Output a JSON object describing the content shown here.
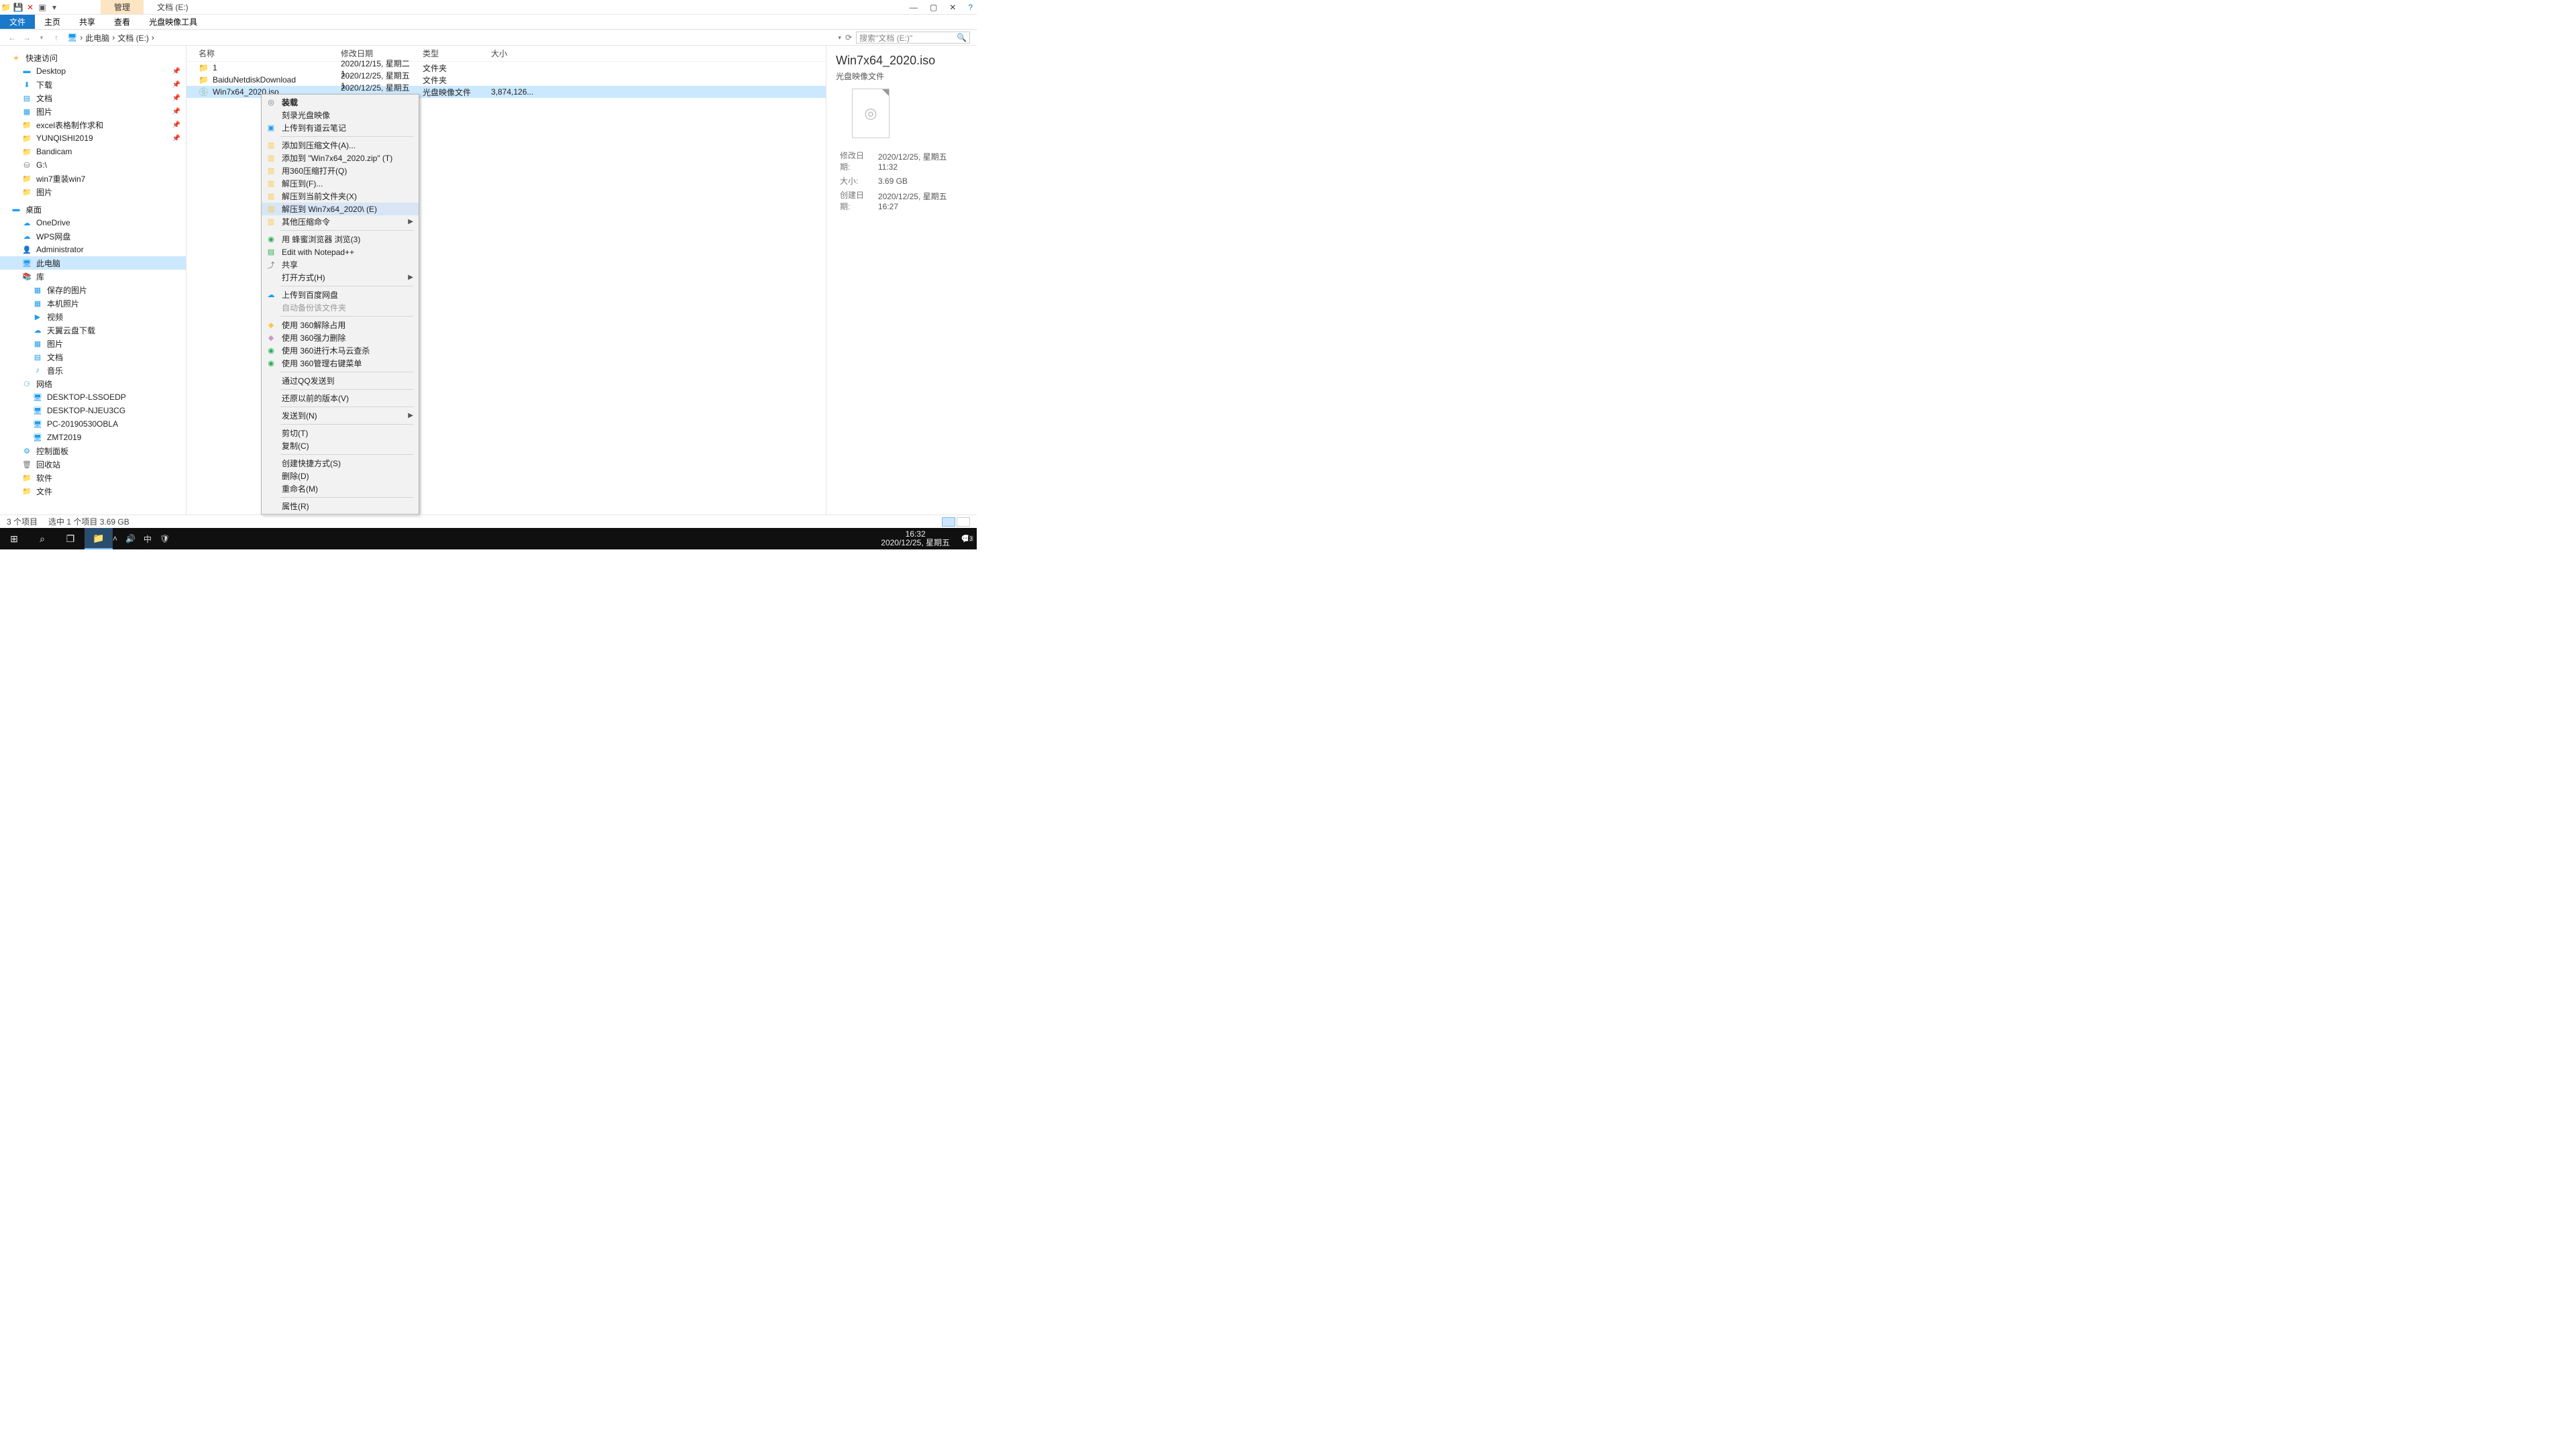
{
  "window": {
    "manage_tab": "管理",
    "location_title": "文档 (E:)",
    "min": "—",
    "max": "▢",
    "close": "✕",
    "help": "?"
  },
  "ribbon": {
    "file": "文件",
    "home": "主页",
    "share": "共享",
    "view": "查看",
    "iso_tools": "光盘映像工具"
  },
  "addr": {
    "this_pc": "此电脑",
    "drive": "文档 (E:)",
    "search_placeholder": "搜索\"文档 (E:)\"",
    "refresh": "⟳"
  },
  "nav": {
    "quick": "快速访问",
    "desktop": "Desktop",
    "downloads": "下载",
    "documents": "文档",
    "pictures_q": "图片",
    "excel": "excel表格制作求和",
    "yunqishi": "YUNQISHI2019",
    "bandicam": "Bandicam",
    "gdrive": "G:\\",
    "win7": "win7重装win7",
    "pictures2": "图片",
    "desktop_root": "桌面",
    "onedrive": "OneDrive",
    "wps": "WPS网盘",
    "admin": "Administrator",
    "this_pc": "此电脑",
    "libraries": "库",
    "saved_pics": "保存的图片",
    "local_photos": "本机照片",
    "videos": "视频",
    "tianyi": "天翼云盘下载",
    "pictures": "图片",
    "docs": "文档",
    "music": "音乐",
    "network": "网络",
    "pc1": "DESKTOP-LSSOEDP",
    "pc2": "DESKTOP-NJEU3CG",
    "pc3": "PC-20190530OBLA",
    "pc4": "ZMT2019",
    "control": "控制面板",
    "recycle": "回收站",
    "software": "软件",
    "files": "文件"
  },
  "cols": {
    "name": "名称",
    "date": "修改日期",
    "type": "类型",
    "size": "大小"
  },
  "rows": [
    {
      "name": "1",
      "date": "2020/12/15, 星期二 1...",
      "type": "文件夹",
      "size": ""
    },
    {
      "name": "BaiduNetdiskDownload",
      "date": "2020/12/25, 星期五 1...",
      "type": "文件夹",
      "size": ""
    },
    {
      "name": "Win7x64_2020.iso",
      "date": "2020/12/25, 星期五 1...",
      "type": "光盘映像文件",
      "size": "3,874,126..."
    }
  ],
  "ctx": {
    "mount": "装载",
    "burn": "刻录光盘映像",
    "youdao": "上传到有道云笔记",
    "add_archive": "添加到压缩文件(A)...",
    "add_zip": "添加到 \"Win7x64_2020.zip\" (T)",
    "open_360": "用360压缩打开(Q)",
    "extract_to": "解压到(F)...",
    "extract_here": "解压到当前文件夹(X)",
    "extract_named": "解压到 Win7x64_2020\\ (E)",
    "other_compress": "其他压缩命令",
    "honey": "用 蜂蜜浏览器 浏览(3)",
    "notepad": "Edit with Notepad++",
    "share": "共享",
    "open_with": "打开方式(H)",
    "baidu": "上传到百度网盘",
    "auto_backup": "自动备份该文件夹",
    "unlock360": "使用 360解除占用",
    "force360": "使用 360强力删除",
    "scan360": "使用 360进行木马云查杀",
    "mgr360": "使用 360管理右键菜单",
    "qq": "通过QQ发送到",
    "restore": "还原以前的版本(V)",
    "send_to": "发送到(N)",
    "cut": "剪切(T)",
    "copy": "复制(C)",
    "shortcut": "创建快捷方式(S)",
    "delete": "删除(D)",
    "rename": "重命名(M)",
    "properties": "属性(R)"
  },
  "preview": {
    "title": "Win7x64_2020.iso",
    "sub": "光盘映像文件",
    "k_mod": "修改日期:",
    "v_mod": "2020/12/25, 星期五 11:32",
    "k_size": "大小:",
    "v_size": "3.69 GB",
    "k_created": "创建日期:",
    "v_created": "2020/12/25, 星期五 16:27"
  },
  "status": {
    "count": "3 个项目",
    "selected": "选中 1 个项目  3.69 GB"
  },
  "taskbar": {
    "ime": "中",
    "time": "16:32",
    "date": "2020/12/25, 星期五",
    "notif_badge": "3"
  }
}
